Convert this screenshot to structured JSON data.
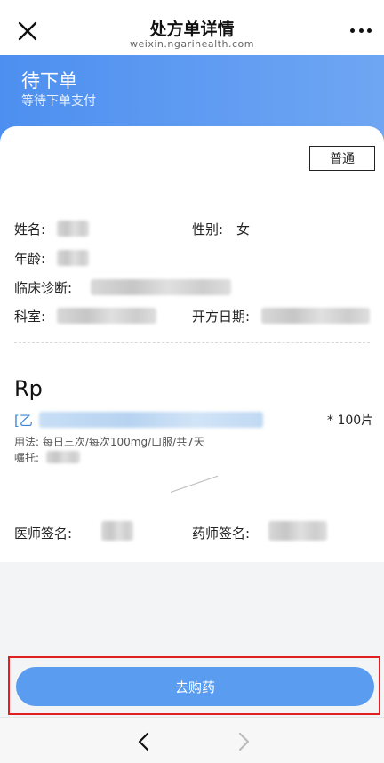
{
  "header": {
    "title": "处方单详情",
    "domain": "weixin.ngarihealth.com"
  },
  "status": {
    "title": "待下单",
    "subtitle": "等待下单支付"
  },
  "prescription": {
    "type_badge": "普通",
    "labels": {
      "name": "姓名:",
      "gender": "性别:",
      "gender_value": "女",
      "age": "年龄:",
      "diagnosis": "临床诊断:",
      "department": "科室:",
      "date": "开方日期:"
    },
    "rp_title": "Rp",
    "drug": {
      "prefix": "[乙",
      "quantity": "* 100片",
      "usage": "用法:  每日三次/每次100mg/口服/共7天",
      "advice_label": "嘱托:"
    },
    "signatures": {
      "doctor_label": "医师签名:",
      "pharmacist_label": "药师签名:"
    }
  },
  "actions": {
    "buy_label": "去购药"
  },
  "icons": {
    "close": "close-icon",
    "more": "more-icon",
    "back": "chevron-left-icon",
    "forward": "chevron-right-icon"
  }
}
